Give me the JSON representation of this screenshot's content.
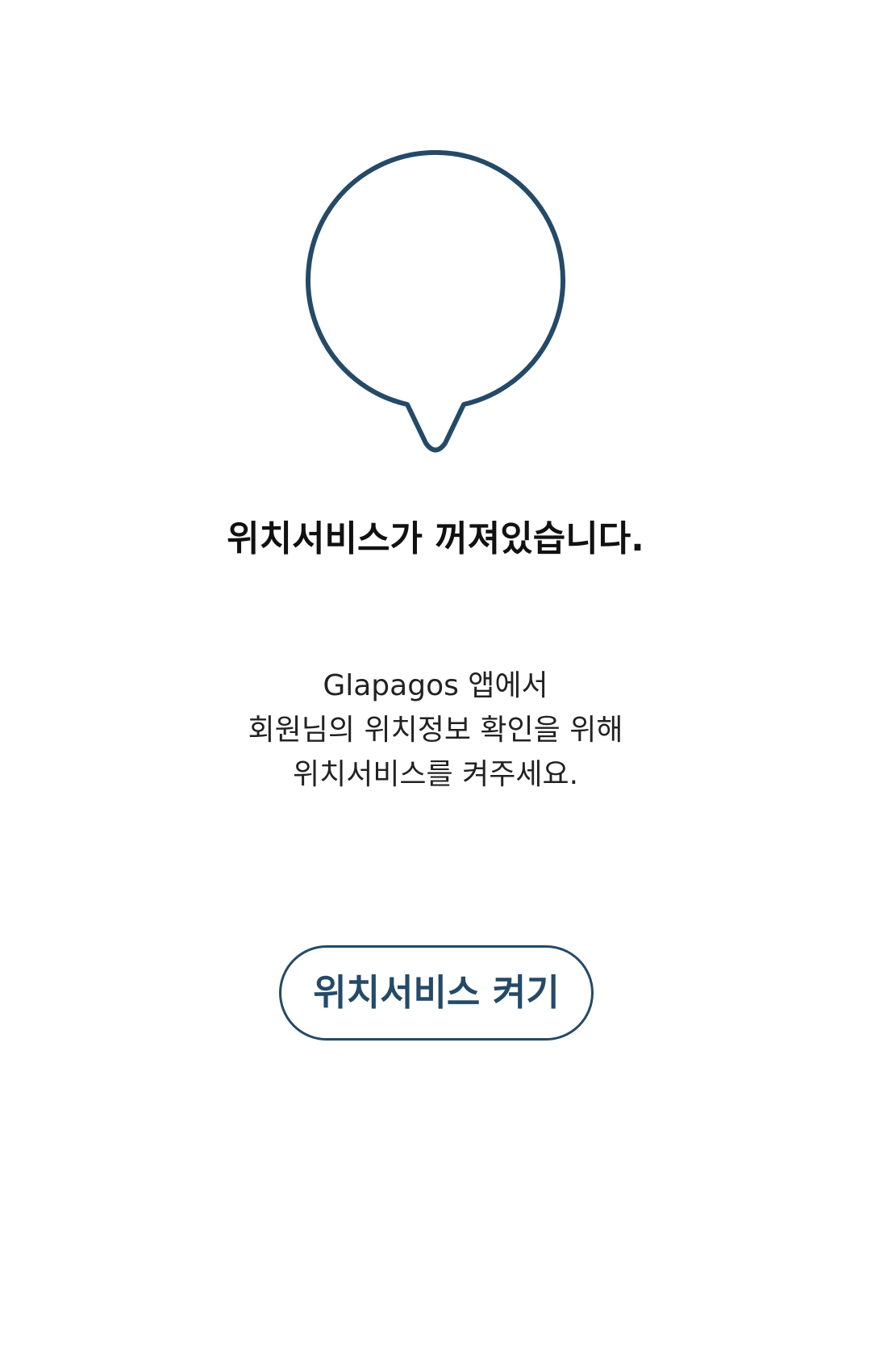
{
  "colors": {
    "accent": "#244a68",
    "title_text": "#111111",
    "body_text": "#222222",
    "background": "#ffffff"
  },
  "icon": {
    "name": "location-pin-icon"
  },
  "message": {
    "title": "위치서비스가 꺼져있습니다.",
    "description_lines": [
      "Glapagos 앱에서",
      "회원님의 위치정보 확인을 위해",
      "위치서비스를 켜주세요."
    ]
  },
  "actions": {
    "enable_location_label": "위치서비스 켜기"
  }
}
